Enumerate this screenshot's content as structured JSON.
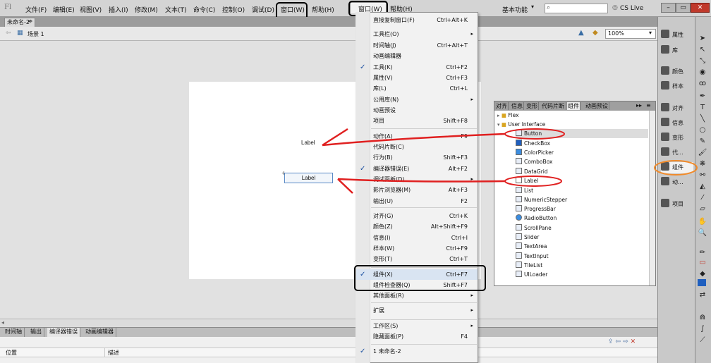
{
  "menubar": {
    "logo": "Fl",
    "items": [
      "文件(F)",
      "编辑(E)",
      "视图(V)",
      "插入(I)",
      "修改(M)",
      "文本(T)",
      "命令(C)",
      "控制(O)",
      "调试(D)",
      "窗口(W)",
      "帮助(H)"
    ],
    "workspace": "基本功能",
    "search_placeholder": "",
    "cs_live": "CS Live"
  },
  "document": {
    "tab": "未命名-2*",
    "scene": "场景 1",
    "zoom": "100%"
  },
  "stage": {
    "label_text": "Label",
    "button_text": "Label"
  },
  "window_menu": {
    "title": "窗口(W)",
    "help": "帮助(H)",
    "items": [
      {
        "label": "直接复制窗口(F)",
        "shortcut": "Ctrl+Alt+K"
      },
      {
        "label": "工具栏(O)",
        "arrow": "▸"
      },
      {
        "label": "时间轴(J)",
        "shortcut": "Ctrl+Alt+T"
      },
      {
        "label": "动画编辑器"
      },
      {
        "label": "工具(K)",
        "shortcut": "Ctrl+F2",
        "check": "✓"
      },
      {
        "label": "属性(V)",
        "shortcut": "Ctrl+F3"
      },
      {
        "label": "库(L)",
        "shortcut": "Ctrl+L"
      },
      {
        "label": "公用库(N)",
        "arrow": "▸"
      },
      {
        "label": "动画预设"
      },
      {
        "label": "项目",
        "shortcut": "Shift+F8"
      },
      {
        "label": "动作(A)",
        "shortcut": "F9"
      },
      {
        "label": "代码片断(C)"
      },
      {
        "label": "行为(B)",
        "shortcut": "Shift+F3"
      },
      {
        "label": "编译器错误(E)",
        "shortcut": "Alt+F2",
        "check": "✓"
      },
      {
        "label": "调试面板(D)",
        "arrow": "▸"
      },
      {
        "label": "影片浏览器(M)",
        "shortcut": "Alt+F3"
      },
      {
        "label": "输出(U)",
        "shortcut": "F2"
      },
      {
        "label": "对齐(G)",
        "shortcut": "Ctrl+K"
      },
      {
        "label": "颜色(Z)",
        "shortcut": "Alt+Shift+F9"
      },
      {
        "label": "信息(I)",
        "shortcut": "Ctrl+I"
      },
      {
        "label": "样本(W)",
        "shortcut": "Ctrl+F9"
      },
      {
        "label": "变形(T)",
        "shortcut": "Ctrl+T"
      },
      {
        "label": "组件(X)",
        "shortcut": "Ctrl+F7",
        "check": "✓"
      },
      {
        "label": "组件检查器(Q)",
        "shortcut": "Shift+F7"
      },
      {
        "label": "其他面板(R)",
        "arrow": "▸"
      },
      {
        "label": "扩展",
        "arrow": "▸"
      },
      {
        "label": "工作区(S)",
        "arrow": "▸"
      },
      {
        "label": "隐藏面板(P)",
        "shortcut": "F4"
      },
      {
        "label": "1 未命名-2",
        "check": "✓"
      }
    ]
  },
  "components_panel": {
    "tabs": [
      "对齐",
      "信息",
      "变形",
      "代码片断",
      "组件",
      "动画预设"
    ],
    "tree": [
      {
        "label": "Flex",
        "indent": 0,
        "folder": true
      },
      {
        "label": "User Interface",
        "indent": 0,
        "folder": true
      },
      {
        "label": "Button",
        "indent": 1
      },
      {
        "label": "CheckBox",
        "indent": 1
      },
      {
        "label": "ColorPicker",
        "indent": 1
      },
      {
        "label": "ComboBox",
        "indent": 1
      },
      {
        "label": "DataGrid",
        "indent": 1
      },
      {
        "label": "Label",
        "indent": 1
      },
      {
        "label": "List",
        "indent": 1
      },
      {
        "label": "NumericStepper",
        "indent": 1
      },
      {
        "label": "ProgressBar",
        "indent": 1
      },
      {
        "label": "RadioButton",
        "indent": 1
      },
      {
        "label": "ScrollPane",
        "indent": 1
      },
      {
        "label": "Slider",
        "indent": 1
      },
      {
        "label": "TextArea",
        "indent": 1
      },
      {
        "label": "TextInput",
        "indent": 1
      },
      {
        "label": "TileList",
        "indent": 1
      },
      {
        "label": "UILoader",
        "indent": 1
      }
    ]
  },
  "right_panel": {
    "items": [
      "属性",
      "库",
      "颜色",
      "样本",
      "对齐",
      "信息",
      "变形",
      "代...",
      "组件",
      "动...",
      "项目"
    ]
  },
  "bottom_panel": {
    "tabs": [
      "时间轴",
      "输出",
      "编译器错误",
      "动画编辑器"
    ],
    "col_location": "位置",
    "col_description": "描述"
  },
  "colors": {
    "annotation_red": "#e02020",
    "annotation_orange": "#f08a2a",
    "annotation_black": "#000000"
  }
}
